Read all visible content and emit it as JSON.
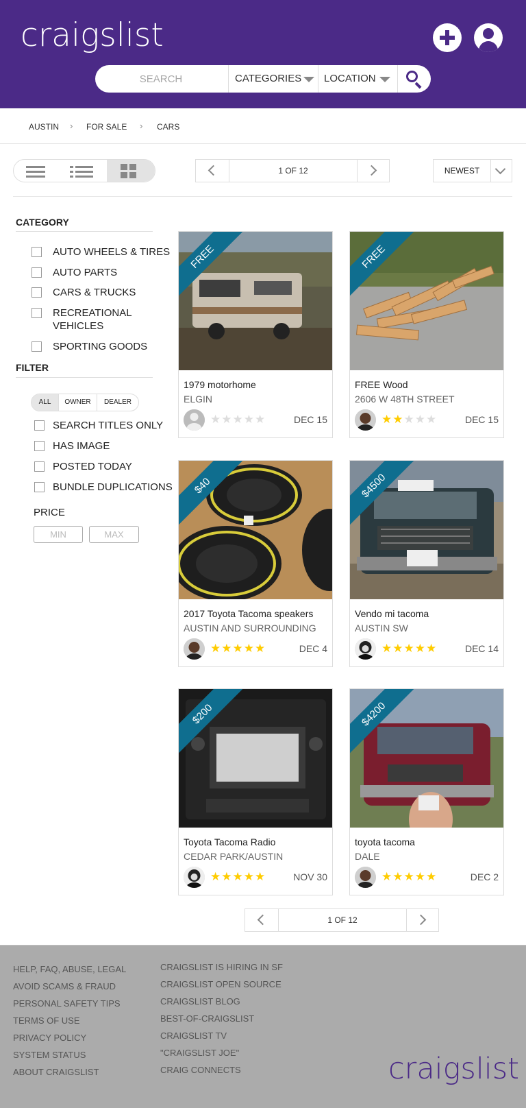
{
  "header": {
    "logo": "craigslist",
    "search_placeholder": "SEARCH",
    "categories_label": "CATEGORIES",
    "location_label": "LOCATION"
  },
  "breadcrumb": [
    "AUSTIN",
    "FOR SALE",
    "CARS"
  ],
  "breadcrumb_sep": "›",
  "pagination": {
    "label": "1 OF 12"
  },
  "sort": {
    "selected": "NEWEST"
  },
  "sidebar": {
    "category_title": "CATEGORY",
    "categories": [
      "AUTO WHEELS & TIRES",
      "AUTO PARTS",
      "CARS & TRUCKS",
      "RECREATIONAL VEHICLES",
      "SPORTING GOODS"
    ],
    "filter_title": "FILTER",
    "seller_types": [
      "ALL",
      "OWNER",
      "DEALER"
    ],
    "seller_selected": "ALL",
    "options": [
      "SEARCH TITLES ONLY",
      "HAS IMAGE",
      "POSTED TODAY",
      "BUNDLE DUPLICATIONS"
    ],
    "price_label": "PRICE",
    "price_min_placeholder": "MIN",
    "price_max_placeholder": "MAX"
  },
  "listings": [
    {
      "price": "FREE",
      "title": "1979 motorhome",
      "location": "ELGIN",
      "rating": 0,
      "date": "DEC 15",
      "image": "motorhome",
      "avatar": "default"
    },
    {
      "price": "FREE",
      "title": "FREE Wood",
      "location": "2606 W 48TH STREET",
      "rating": 2,
      "date": "DEC 15",
      "image": "wood",
      "avatar": "person"
    },
    {
      "price": "$40",
      "title": "2017 Toyota Tacoma speakers",
      "location": "AUSTIN AND SURROUNDING",
      "rating": 5,
      "date": "DEC 4",
      "image": "speakers",
      "avatar": "person"
    },
    {
      "price": "$4500",
      "title": "Vendo mi tacoma",
      "location": "AUSTIN SW",
      "rating": 5,
      "date": "DEC 14",
      "image": "truck-dark",
      "avatar": "person-bw"
    },
    {
      "price": "$200",
      "title": "Toyota Tacoma Radio",
      "location": "CEDAR PARK/AUSTIN",
      "rating": 5,
      "date": "NOV 30",
      "image": "radio",
      "avatar": "person-bw"
    },
    {
      "price": "$4200",
      "title": "toyota tacoma",
      "location": "DALE",
      "rating": 5,
      "date": "DEC 2",
      "image": "truck-red",
      "avatar": "person"
    }
  ],
  "footer": {
    "col1": [
      "HELP, FAQ, ABUSE, LEGAL",
      "AVOID SCAMS & FRAUD",
      "PERSONAL SAFETY TIPS",
      "TERMS OF USE",
      "PRIVACY POLICY",
      "SYSTEM STATUS",
      "ABOUT CRAIGSLIST"
    ],
    "col2": [
      "CRAIGSLIST IS HIRING IN SF",
      "CRAIGSLIST OPEN SOURCE",
      "CRAIGSLIST BLOG",
      "BEST-OF-CRAIGSLIST",
      "CRAIGSLIST TV",
      "\"CRAIGSLIST JOE\"",
      "CRAIG CONNECTS"
    ],
    "logo": "craigslist"
  },
  "colors": {
    "brand": "#4b2a87",
    "ribbon": "#0f6e8f",
    "star": "#ffcc00",
    "footer_bg": "#ababab"
  }
}
